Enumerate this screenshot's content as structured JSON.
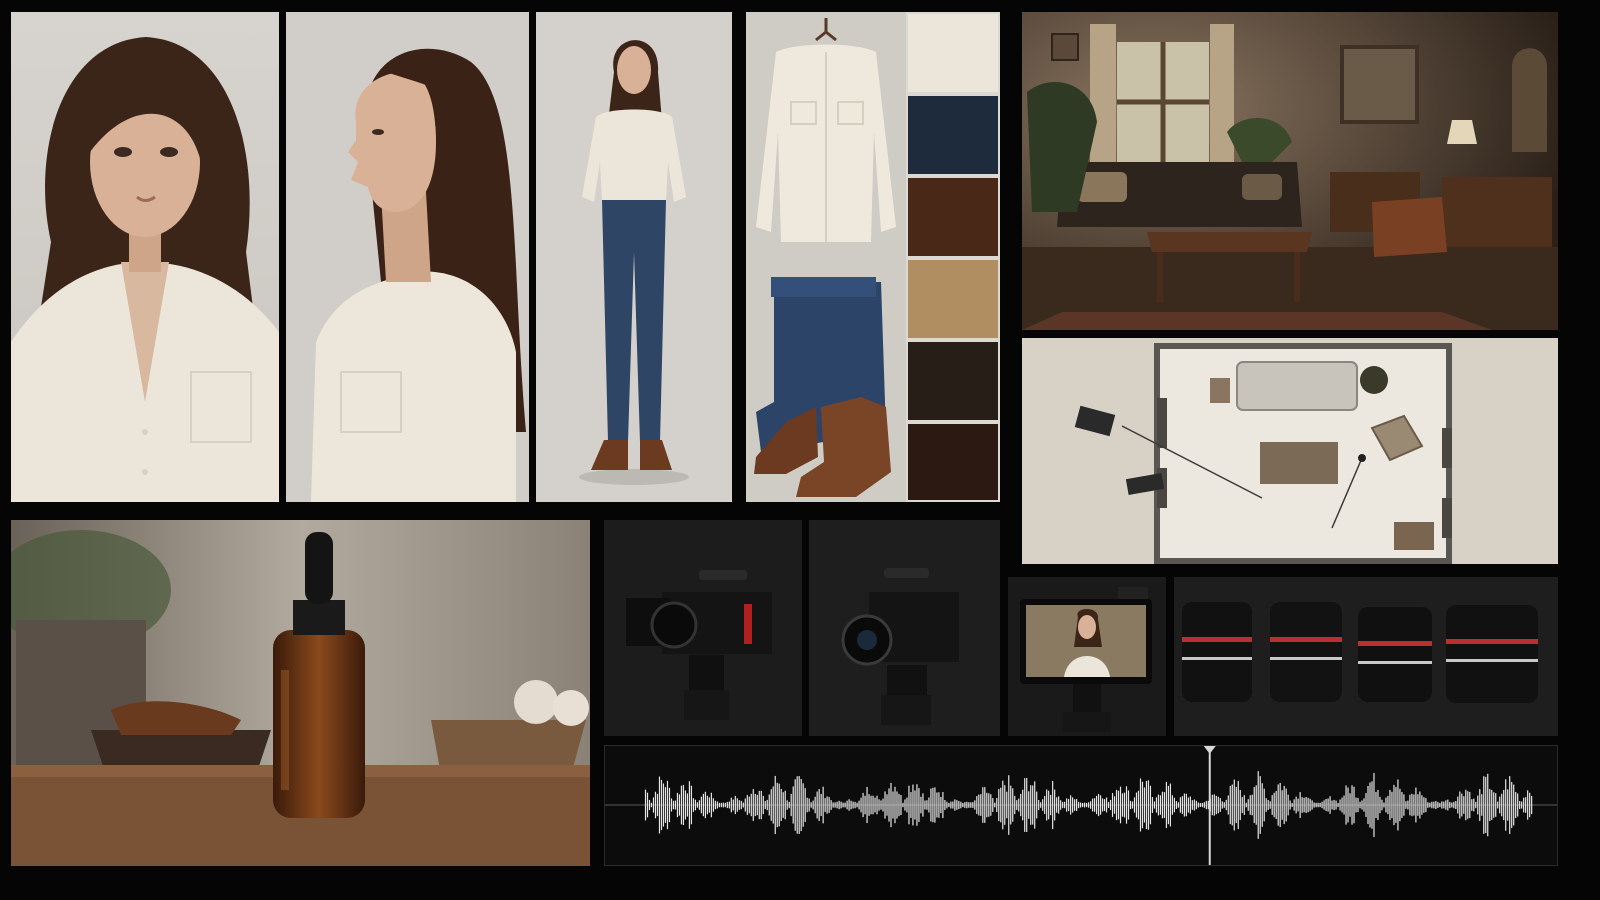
{
  "board": {
    "background": "#050505",
    "panels": [
      {
        "id": "portrait-front",
        "subject": "woman-portrait-front"
      },
      {
        "id": "portrait-profile",
        "subject": "woman-portrait-profile"
      },
      {
        "id": "full-body",
        "subject": "woman-full-body-outfit"
      },
      {
        "id": "wardrobe",
        "subject": "wardrobe-shirt-jeans-boots"
      },
      {
        "id": "swatches",
        "subject": "color-palette"
      },
      {
        "id": "living-room",
        "subject": "set-living-room"
      },
      {
        "id": "floor-plan",
        "subject": "camera-floor-plan"
      },
      {
        "id": "product",
        "subject": "amber-dropper-bottle"
      },
      {
        "id": "camera-a",
        "subject": "cinema-camera-rig"
      },
      {
        "id": "camera-b",
        "subject": "cinema-camera-rig"
      },
      {
        "id": "monitor",
        "subject": "field-monitor"
      },
      {
        "id": "lenses",
        "subject": "prime-lens-set"
      },
      {
        "id": "waveform",
        "subject": "audio-waveform"
      }
    ]
  },
  "palette": {
    "swatches": [
      "#ece6da",
      "#1e2b3c",
      "#4a2818",
      "#b08e62",
      "#281e18",
      "#2c1a12"
    ]
  },
  "colors": {
    "studio_gray": "#d3d0cb",
    "shirt_cream": "#efe9dd",
    "hair_brown": "#3b2418",
    "denim": "#2f4566",
    "boot_brown": "#6b3a20",
    "amber": "#6a3412",
    "waveform": "#e6e6e6"
  }
}
